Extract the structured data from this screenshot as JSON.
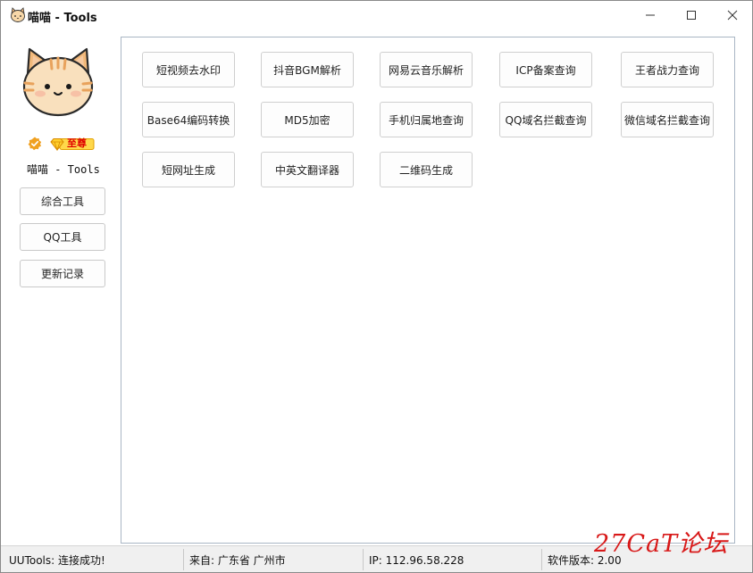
{
  "window": {
    "title": "喵喵 - Tools"
  },
  "sidebar": {
    "username": "喵喵 - Tools",
    "vip_label": "至尊",
    "buttons": [
      {
        "label": "综合工具"
      },
      {
        "label": "QQ工具"
      },
      {
        "label": "更新记录"
      }
    ]
  },
  "tools": [
    {
      "label": "短视频去水印"
    },
    {
      "label": "抖音BGM解析"
    },
    {
      "label": "网易云音乐解析"
    },
    {
      "label": "ICP备案查询"
    },
    {
      "label": "王者战力查询"
    },
    {
      "label": "Base64编码转换"
    },
    {
      "label": "MD5加密"
    },
    {
      "label": "手机归属地查询"
    },
    {
      "label": "QQ域名拦截查询"
    },
    {
      "label": "微信域名拦截查询"
    },
    {
      "label": "短网址生成"
    },
    {
      "label": "中英文翻译器"
    },
    {
      "label": "二维码生成"
    }
  ],
  "status": {
    "connection": "UUTools: 连接成功!",
    "location": "来自: 广东省 广州市",
    "ip": "IP: 112.96.58.228",
    "version": "软件版本: 2.00"
  },
  "watermark": "27CaT论坛",
  "colors": {
    "panel_border": "#a9b6c4",
    "vip_red": "#e00000",
    "watermark_red": "#d81818",
    "cat_orange": "#f2b97a"
  },
  "icons": {
    "app": "cat-face-icon",
    "minimize": "minimize-icon",
    "maximize": "maximize-icon",
    "close": "close-icon",
    "verified": "verified-badge-icon",
    "vip": "diamond-vip-icon"
  }
}
